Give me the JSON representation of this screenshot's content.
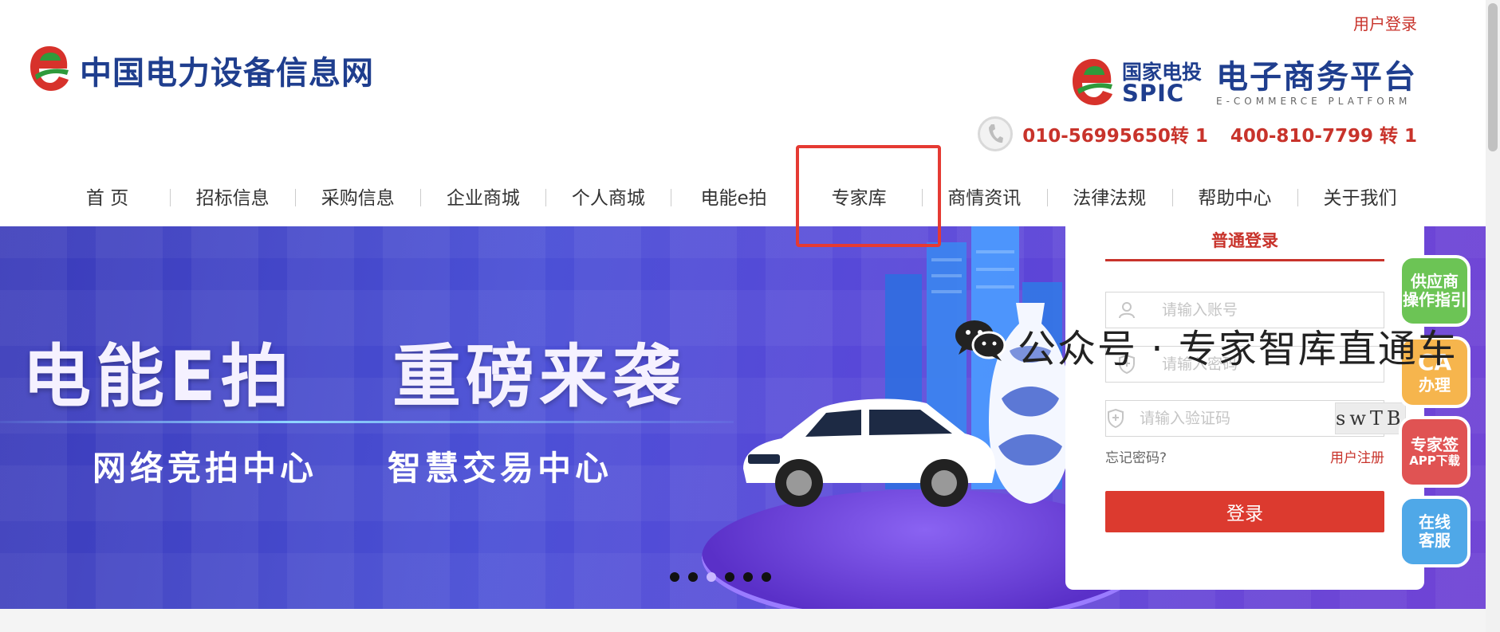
{
  "header": {
    "user_login": "用户登录",
    "site_title": "中国电力设备信息网",
    "spic_cn": "国家电投",
    "spic_en": "SPIC",
    "ec_title": "电子商务平台",
    "ec_subtitle": "E-COMMERCE PLATFORM",
    "phone_1": "010-56995650转 1",
    "phone_2": "400-810-7799 转 1"
  },
  "nav": {
    "items": [
      "首 页",
      "招标信息",
      "采购信息",
      "企业商城",
      "个人商城",
      "电能e拍",
      "专家库",
      "商情资讯",
      "法律法规",
      "帮助中心",
      "关于我们"
    ],
    "highlighted": "专家库"
  },
  "banner": {
    "headline_1": "电能E拍",
    "headline_2": "重磅来袭",
    "sub_1": "网络竞拍中心",
    "sub_2": "智慧交易中心",
    "dot_count": 6,
    "active_dot": 3
  },
  "login": {
    "tab_label": "普通登录",
    "account_placeholder": "请输入账号",
    "password_placeholder": "请输入密码",
    "captcha_placeholder": "请输入验证码",
    "captcha_text": "swTB",
    "forgot_label": "忘记密码?",
    "register_label": "用户注册",
    "submit_label": "登录"
  },
  "side_buttons": [
    {
      "line1": "供应商",
      "line2": "操作指引",
      "color": "#6cc455"
    },
    {
      "line1": "CA",
      "line2": "办理",
      "color": "#f6b54d"
    },
    {
      "line1": "专家签",
      "line2": "APP下载",
      "color": "#e05353"
    },
    {
      "line1": "在线",
      "line2": "客服",
      "color": "#4fa8e8"
    }
  ],
  "watermark": {
    "text": "公众号 · 专家智库直通车"
  },
  "colors": {
    "brand_red": "#c8332b",
    "brand_blue": "#1f3e8e",
    "highlight_border": "#e53a33",
    "login_button": "#dc3a2f"
  }
}
